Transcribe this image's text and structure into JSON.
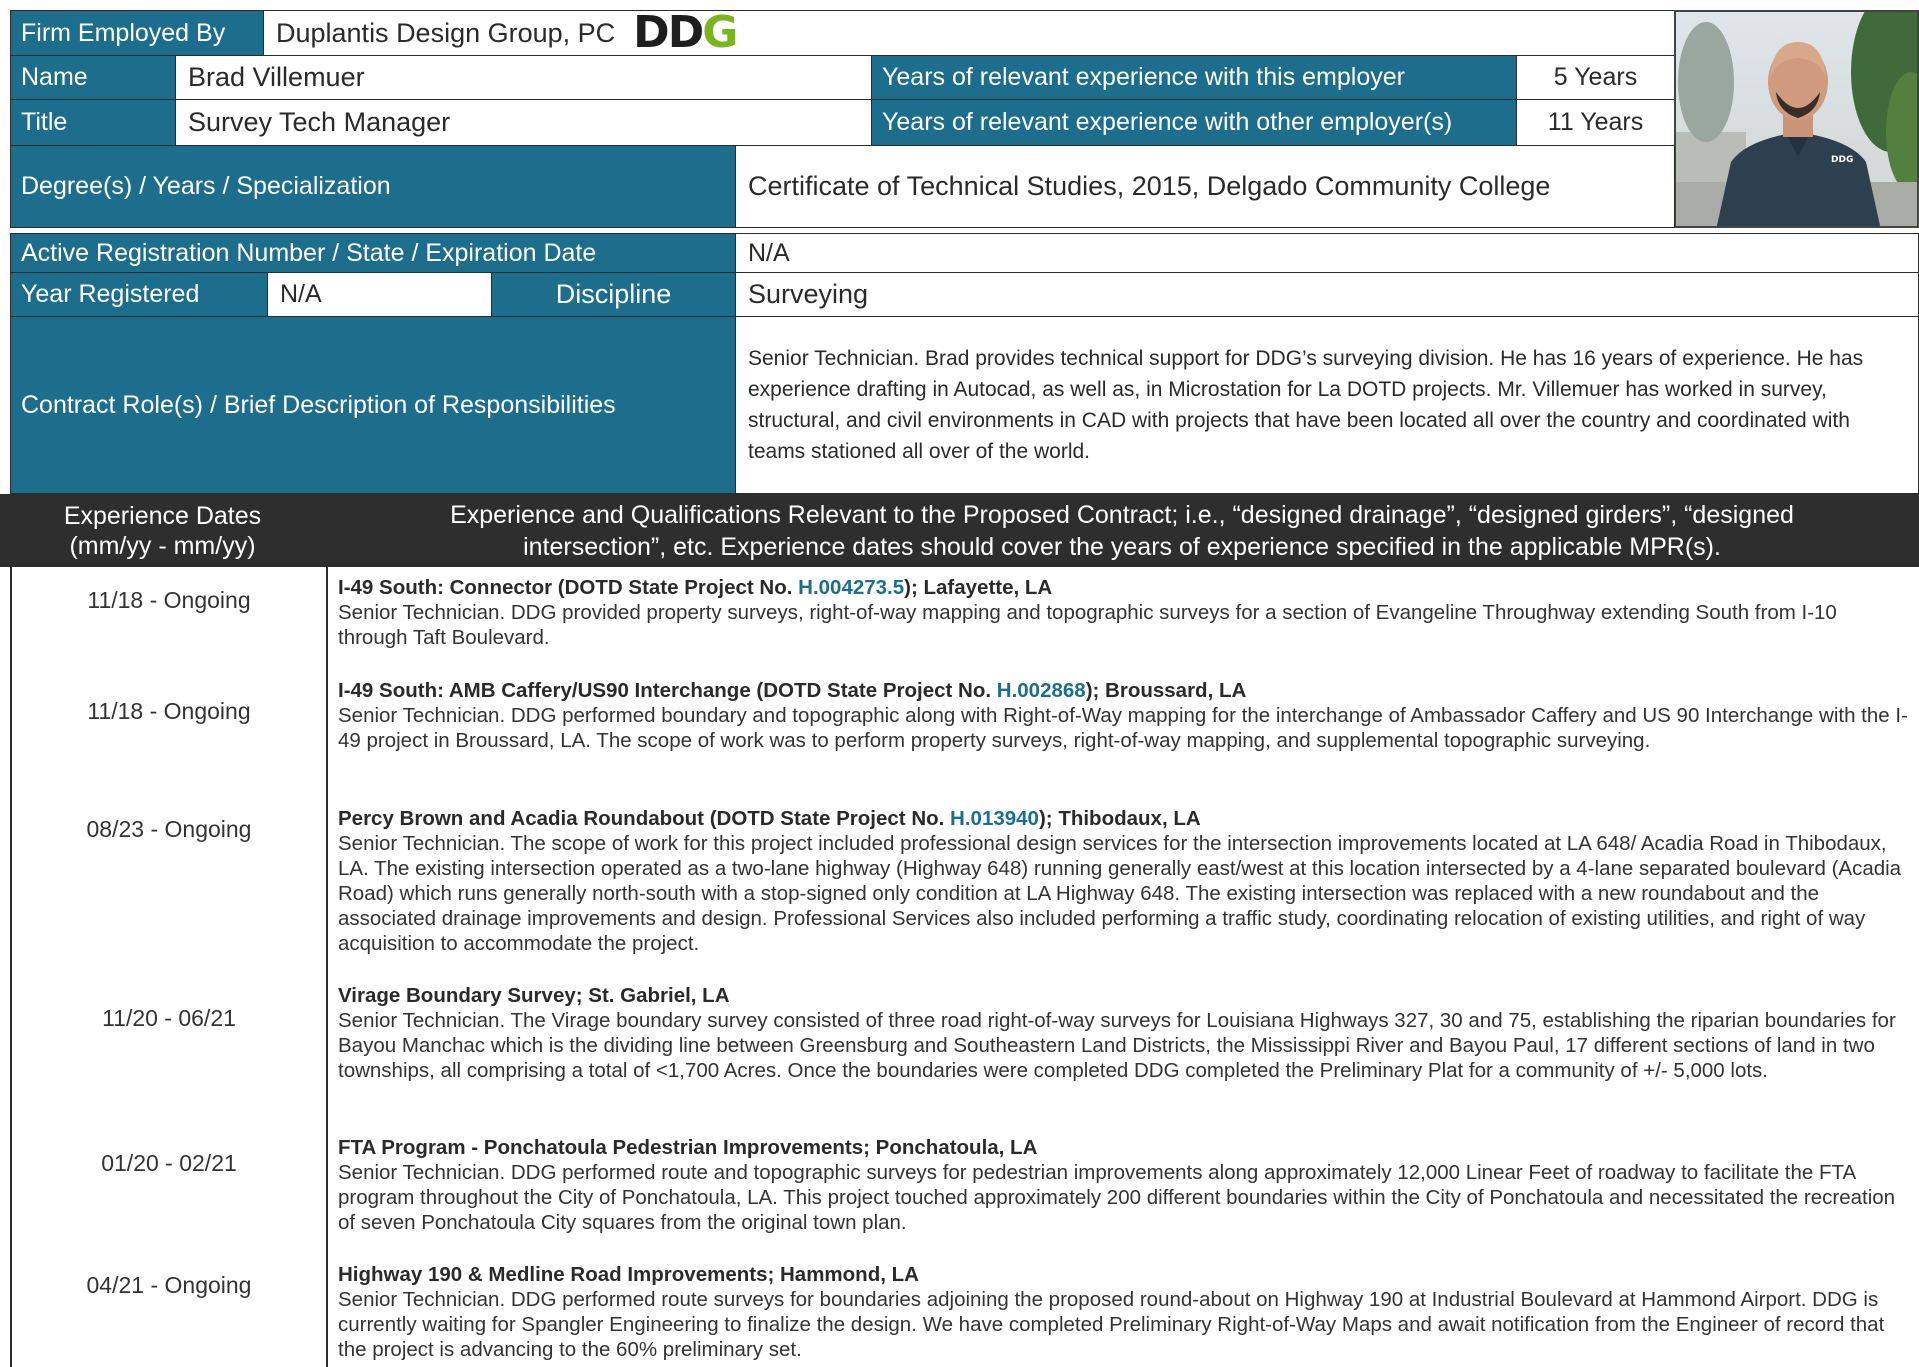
{
  "header": {
    "firm_label": "Firm Employed By",
    "firm_value": "Duplantis Design Group, PC",
    "logo_text": "DDG",
    "name_label": "Name",
    "name_value": "Brad Villemuer",
    "title_label": "Title",
    "title_value": "Survey Tech Manager",
    "years_this_label": "Years of relevant experience with this employer",
    "years_this_value": "5 Years",
    "years_other_label": "Years of relevant experience with other employer(s)",
    "years_other_value": "11 Years",
    "photo_shirt_logo": "DDG"
  },
  "details": {
    "degree_label": "Degree(s) / Years / Specialization",
    "degree_value": "Certificate of Technical Studies, 2015, Delgado Community College",
    "registration_label": "Active Registration Number / State / Expiration Date",
    "registration_value": "N/A",
    "year_registered_label": "Year Registered",
    "year_registered_value": "N/A",
    "discipline_label": "Discipline",
    "discipline_value": "Surveying",
    "role_label": "Contract Role(s) /  Brief Description of Responsibilities",
    "role_value": "Senior Technician. Brad provides technical support for DDG’s surveying division. He has 16 years of experience. He has experience drafting in Autocad, as well as, in Microstation for La DOTD projects. Mr. Villemuer has worked in survey, structural, and civil environments in CAD with projects that have been located all over the country and coordinated with teams stationed all over of the world."
  },
  "experience_header": {
    "dates_line1": "Experience Dates",
    "dates_line2": "(mm/yy - mm/yy)",
    "quals_line1": "Experience and Qualifications Relevant to the Proposed Contract; i.e., “designed drainage”, “designed girders”, “designed",
    "quals_line2": "intersection”, etc.  Experience dates should cover the years of experience specified in the applicable MPR(s)."
  },
  "projects": [
    {
      "dates": "11/18 - Ongoing",
      "title_pre": "I-49 South: Connector (DOTD State Project No. ",
      "code": "H.004273.5",
      "title_post": "); Lafayette, LA",
      "body": "Senior Technician. DDG provided property surveys, right-of-way mapping and topographic surveys for a section of Evangeline Throughway extending South from I-10 through Taft Boulevard."
    },
    {
      "dates": "11/18 - Ongoing",
      "title_pre": "I-49 South: AMB Caffery/US90 Interchange (DOTD State Project No. ",
      "code": "H.002868",
      "title_post": "); Broussard, LA",
      "body": "Senior Technician. DDG performed boundary and topographic along with Right-of-Way mapping for the interchange of Ambassador Caffery and US 90 Interchange with the I-49 project in Broussard, LA. The scope of work was to perform property surveys, right-of-way mapping, and supplemental topographic surveying."
    },
    {
      "dates": "08/23 - Ongoing",
      "title_pre": "Percy Brown and Acadia Roundabout (DOTD State Project No. ",
      "code": "H.013940",
      "title_post": "); Thibodaux, LA",
      "body": "Senior Technician. The scope of work for this project included professional design services for the intersection improvements located at LA 648/ Acadia Road in Thibodaux, LA. The existing intersection operated as a two-lane highway (Highway 648) running generally east/west at this location intersected by a 4-lane separated boulevard (Acadia Road) which runs generally north-south with a stop-signed only condition at LA Highway 648. The existing intersection was replaced with a new roundabout and the associated drainage improvements and design. Professional Services also included performing a traffic study, coordinating relocation of existing utilities, and right of way acquisition to accommodate the project."
    },
    {
      "dates": "11/20 - 06/21",
      "title_pre": "Virage Boundary Survey; St. Gabriel, LA",
      "code": "",
      "title_post": "",
      "body": "Senior Technician. The Virage boundary survey consisted of three road right-of-way  surveys for Louisiana Highways 327, 30 and 75, establishing the riparian boundaries for Bayou Manchac which is the dividing line between Greensburg and Southeastern Land Districts, the Mississippi River and Bayou Paul, 17 different sections of land in two townships, all comprising a total of <1,700 Acres. Once the boundaries were completed DDG completed the Preliminary Plat for a community of +/- 5,000 lots."
    },
    {
      "dates": "01/20 - 02/21",
      "title_pre": "FTA Program - Ponchatoula Pedestrian Improvements; Ponchatoula, LA",
      "code": "",
      "title_post": "",
      "body": "Senior Technician. DDG performed route and topographic surveys for pedestrian improvements along approximately 12,000 Linear Feet of roadway to facilitate the FTA program throughout the City of Ponchatoula, LA. This project touched approximately 200 different boundaries within the City of Ponchatoula and necessitated the recreation of seven Ponchatoula City squares from the original town plan."
    },
    {
      "dates": "04/21 - Ongoing",
      "title_pre": "Highway 190 & Medline Road Improvements; Hammond, LA",
      "code": "",
      "title_post": "",
      "body": "Senior Technician.  DDG performed route surveys for boundaries adjoining the proposed round-about on Highway 190 at Industrial Boulevard at Hammond Airport. DDG is currently waiting for Spangler Engineering to finalize the design. We have completed Preliminary Right-of-Way Maps and await notification from the Engineer of record that the project is advancing to the 60% preliminary set."
    }
  ]
}
